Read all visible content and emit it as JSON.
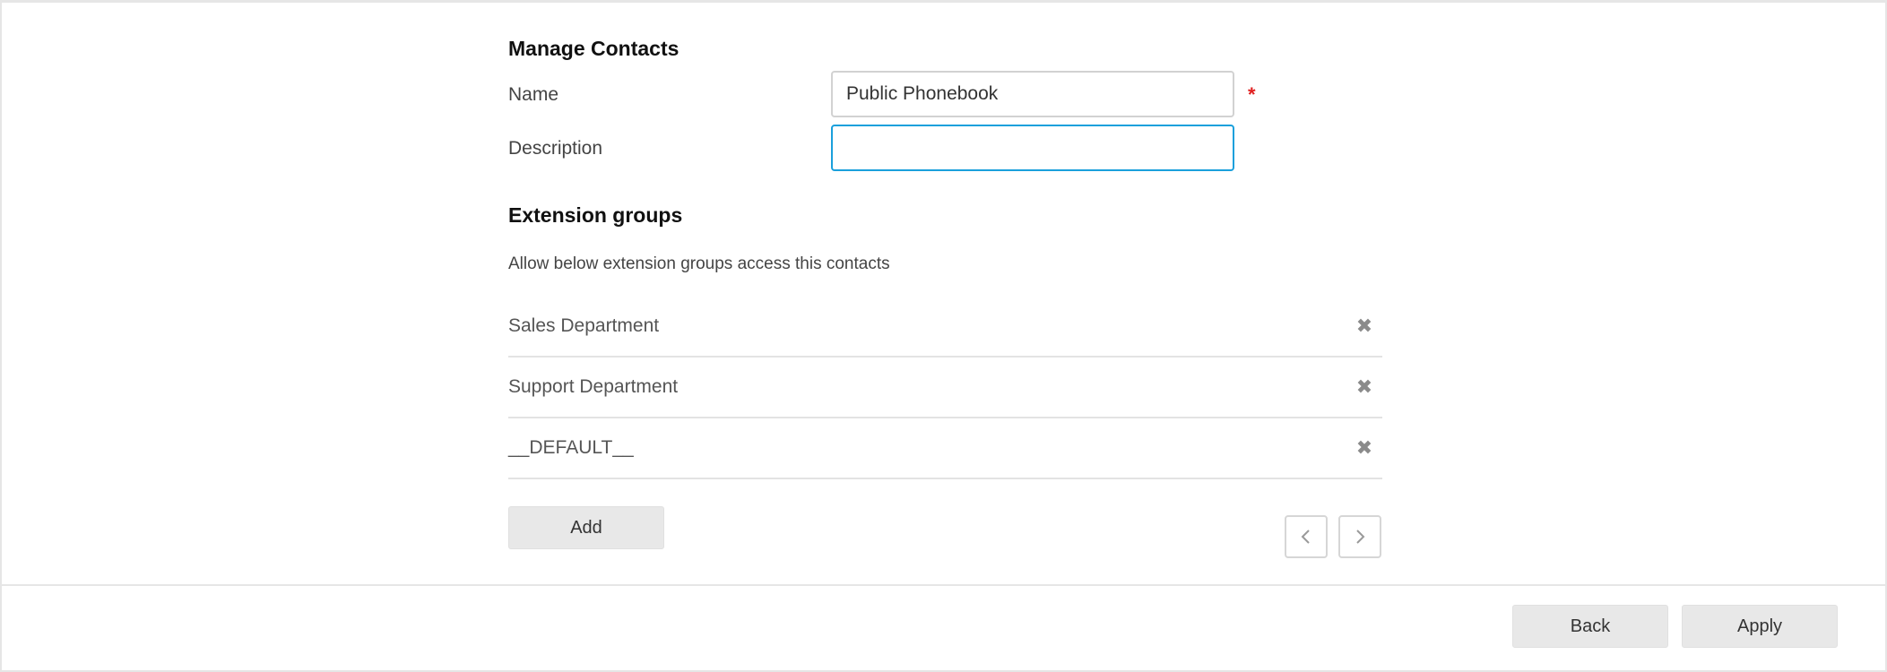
{
  "manage_contacts": {
    "title": "Manage Contacts",
    "name_label": "Name",
    "name_value": "Public Phonebook",
    "description_label": "Description",
    "description_value": "",
    "required_mark": "*"
  },
  "extension_groups": {
    "title": "Extension groups",
    "hint": "Allow below extension groups access this contacts",
    "items": [
      {
        "name": "Sales Department"
      },
      {
        "name": "Support Department"
      },
      {
        "name": "__DEFAULT__"
      }
    ],
    "add_label": "Add"
  },
  "pagination": {
    "prev_icon": "chevron-left-icon",
    "next_icon": "chevron-right-icon"
  },
  "footer": {
    "back_label": "Back",
    "apply_label": "Apply"
  },
  "colors": {
    "focus_border": "#1aa0dc",
    "required": "#e02020",
    "button_bg": "#e8e8e8"
  }
}
